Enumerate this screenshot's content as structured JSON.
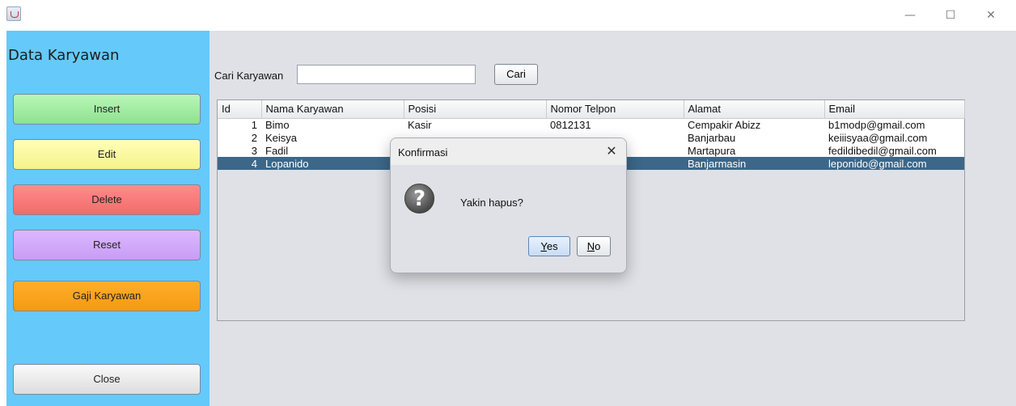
{
  "window": {
    "minimize_glyph": "—",
    "maximize_glyph": "☐",
    "close_glyph": "✕"
  },
  "sidebar": {
    "title": "Data Karyawan",
    "buttons": {
      "insert": "Insert",
      "edit": "Edit",
      "delete": "Delete",
      "reset": "Reset",
      "gaji": "Gaji Karyawan",
      "close": "Close"
    },
    "colors": {
      "background": "#65c9fa",
      "insert": "#a6ecaa",
      "edit": "#fbfb9a",
      "delete": "#f87878",
      "reset": "#d0aaf9",
      "gaji": "#f7a21a"
    }
  },
  "search": {
    "label": "Cari Karyawan",
    "value": "",
    "button": "Cari"
  },
  "table": {
    "columns": [
      "Id",
      "Nama Karyawan",
      "Posisi",
      "Nomor Telpon",
      "Alamat",
      "Email"
    ],
    "rows": [
      [
        "1",
        "Bimo",
        "Kasir",
        "0812131",
        "Cempakir Abizz",
        "b1modp@gmail.com"
      ],
      [
        "2",
        "Keisya",
        "",
        "",
        "Banjarbau",
        "keiiisyaa@gmail.com"
      ],
      [
        "3",
        "Fadil",
        "",
        "",
        "Martapura",
        "fedildibedil@gmail.com"
      ],
      [
        "4",
        "Lopanido",
        "",
        "",
        "Banjarmasin",
        "leponido@gmail.com"
      ]
    ],
    "selected_row": 4,
    "selection_color": "#3c6788"
  },
  "dialog": {
    "title": "Konfirmasi",
    "message": "Yakin hapus?",
    "icon": "question-icon",
    "yes_first": "Y",
    "yes_rest": "es",
    "no_first": "N",
    "no_rest": "o",
    "close_glyph": "✕"
  }
}
